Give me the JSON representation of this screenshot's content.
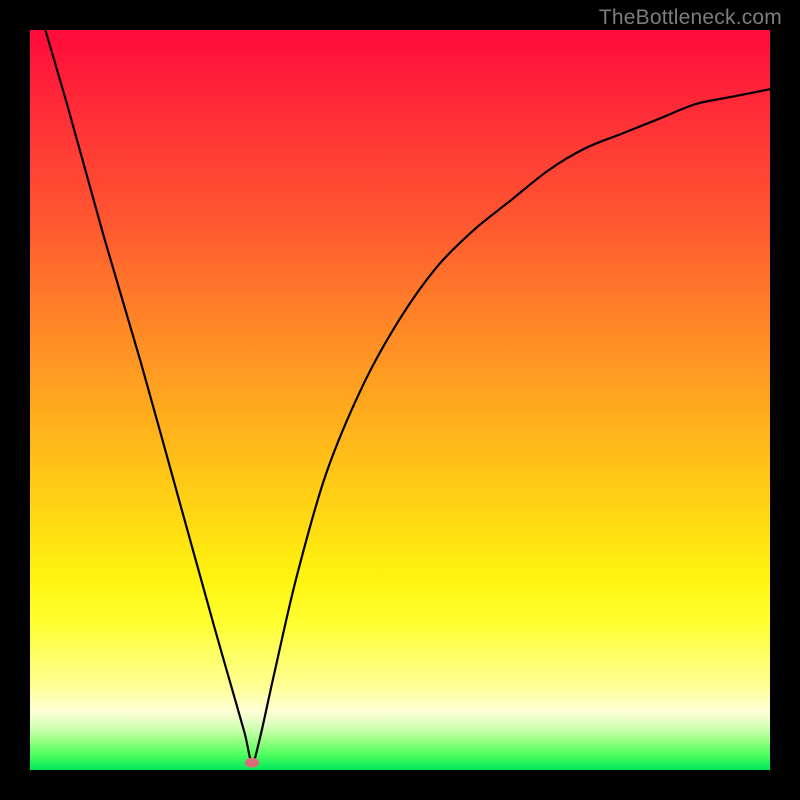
{
  "watermark": "TheBottleneck.com",
  "chart_data": {
    "type": "line",
    "title": "",
    "xlabel": "",
    "ylabel": "",
    "xlim": [
      0,
      100
    ],
    "ylim": [
      0,
      100
    ],
    "grid": false,
    "legend": false,
    "series": [
      {
        "name": "bottleneck-curve",
        "x": [
          0,
          5,
          10,
          15,
          20,
          25,
          27,
          29,
          30,
          31,
          33,
          36,
          40,
          45,
          50,
          55,
          60,
          65,
          70,
          75,
          80,
          85,
          90,
          95,
          100
        ],
        "values": [
          107,
          90,
          72,
          55,
          37,
          19,
          12,
          5,
          1,
          4,
          13,
          26,
          40,
          52,
          61,
          68,
          73,
          77,
          81,
          84,
          86,
          88,
          90,
          91,
          92
        ]
      }
    ],
    "marker": {
      "name": "optimum-point",
      "x": 30,
      "y": 1
    },
    "background": {
      "type": "vertical-gradient",
      "stops": [
        {
          "pos": 0.0,
          "color": "#ff0a3a"
        },
        {
          "pos": 0.5,
          "color": "#ff9a22"
        },
        {
          "pos": 0.78,
          "color": "#ffff30"
        },
        {
          "pos": 1.0,
          "color": "#00e65a"
        }
      ]
    }
  }
}
